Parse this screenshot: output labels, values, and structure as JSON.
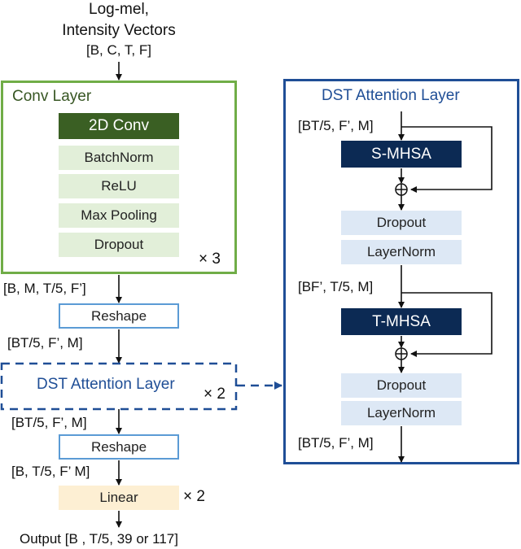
{
  "input": {
    "line1": "Log-mel,",
    "line2": "Intensity Vectors",
    "shape": "[B, C, T, F]"
  },
  "conv_layer": {
    "title": "Conv Layer",
    "blocks": [
      "2D Conv",
      "BatchNorm",
      "ReLU",
      "Max Pooling",
      "Dropout"
    ],
    "repeat": "× 3"
  },
  "main_flow": {
    "shape_after_conv": "[B, M, T/5, F’]",
    "reshape1": "Reshape",
    "shape_after_reshape1": "[BT/5, F’, M]",
    "dst_block": "DST Attention Layer",
    "dst_repeat": "× 2",
    "shape_after_dst": "[BT/5, F’, M]",
    "reshape2": "Reshape",
    "shape_after_reshape2": "[B, T/5, F’ M]",
    "linear": "Linear",
    "linear_repeat": "× 2",
    "output": "Output [B , T/5, 39 or 117]"
  },
  "dst_detail": {
    "title": "DST Attention Layer",
    "shape_in": "[BT/5, F’, M]",
    "s_mhsa": "S-MHSA",
    "dropout1": "Dropout",
    "layernorm1": "LayerNorm",
    "shape_mid": "[BF’, T/5, M]",
    "t_mhsa": "T-MHSA",
    "dropout2": "Dropout",
    "layernorm2": "LayerNorm",
    "shape_out": "[BT/5, F’, M]",
    "add_symbol": "⊕"
  },
  "colors": {
    "conv_border": "#70ad47",
    "conv_dark": "#3a5f23",
    "conv_light": "#e2efd9",
    "dst_border": "#1f4e96",
    "mhsa_dark": "#0c2a54",
    "dst_light": "#dde8f5",
    "reshape_border": "#5b9bd5",
    "linear_fill": "#fdefd3"
  }
}
